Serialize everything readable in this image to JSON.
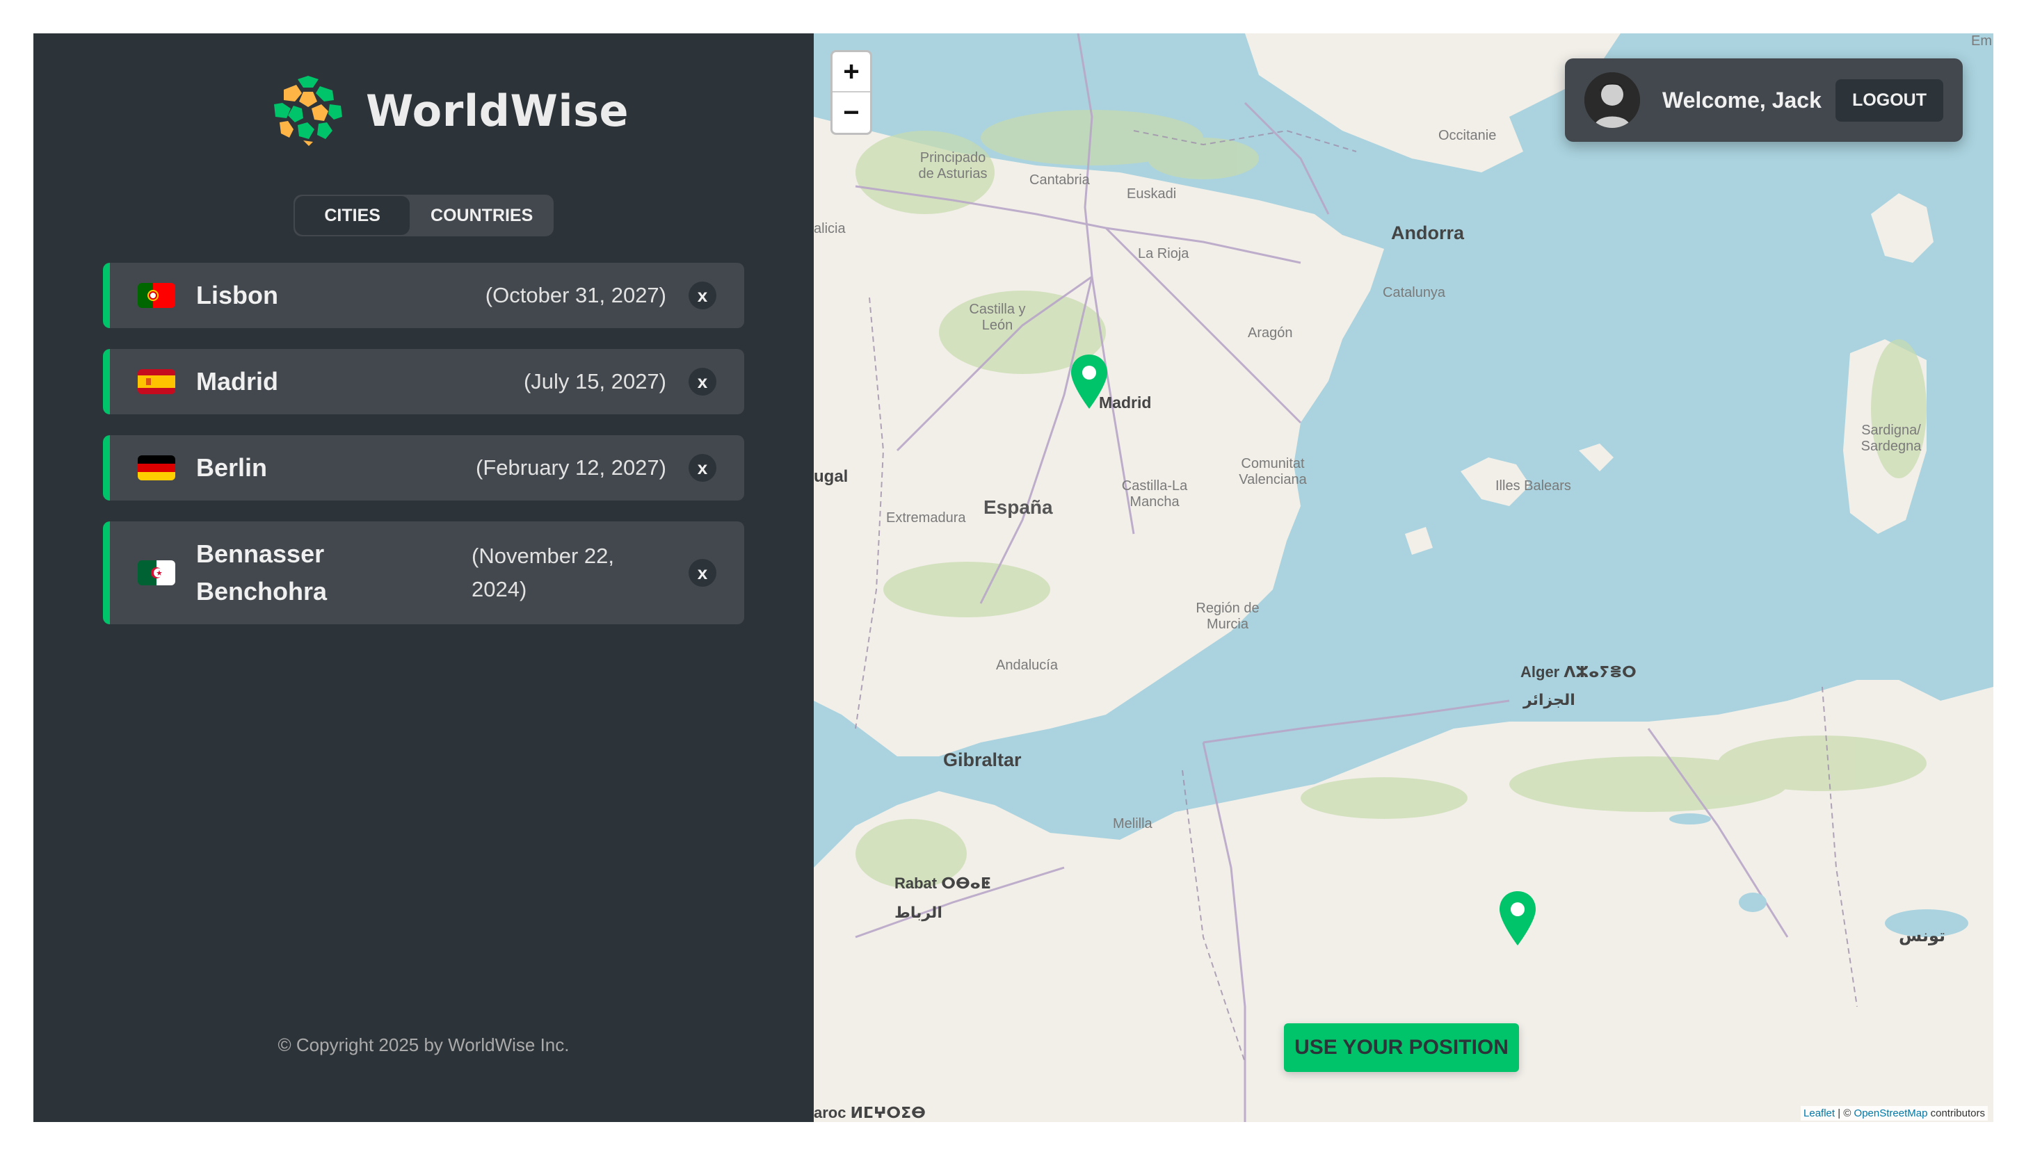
{
  "brand": {
    "name": "WorldWise"
  },
  "tabs": [
    {
      "label": "CITIES",
      "active": true
    },
    {
      "label": "COUNTRIES",
      "active": false
    }
  ],
  "cities": [
    {
      "name": "Lisbon",
      "date": "(October 31, 2027)",
      "flag": "portugal",
      "delete_label": "x"
    },
    {
      "name": "Madrid",
      "date": "(July 15, 2027)",
      "flag": "spain",
      "delete_label": "x"
    },
    {
      "name": "Berlin",
      "date": "(February 12, 2027)",
      "flag": "germany",
      "delete_label": "x"
    },
    {
      "name": "Bennasser Benchohra",
      "date": "(November 22, 2024)",
      "flag": "algeria",
      "delete_label": "x"
    }
  ],
  "footer": {
    "copyright": "© Copyright 2025 by WorldWise Inc."
  },
  "map": {
    "zoom_in": "+",
    "zoom_out": "−",
    "user": {
      "welcome": "Welcome, Jack",
      "logout_label": "LOGOUT"
    },
    "use_position_label": "USE YOUR POSITION",
    "attribution": {
      "leaflet": "Leaflet",
      "sep": "| ©",
      "osm": "OpenStreetMap",
      "suffix": "contributors"
    },
    "labels": {
      "andorra": "Andorra",
      "madrid": "Madrid",
      "espana": "España",
      "gibraltar": "Gibraltar",
      "alger": "Alger ⴷⵣⴰⵢⴻⵔ",
      "alger_ar": "الجزائر",
      "rabat": "Rabat ⵔⴱⴰⵟ",
      "rabat_ar": "الرباط",
      "tunis_ar": "تونس",
      "asturias": "Principado de Asturias",
      "cantabria": "Cantabria",
      "euskadi": "Euskadi",
      "la_rioja": "La Rioja",
      "catalunya": "Catalunya",
      "aragon": "Aragón",
      "castilla_leon": "Castilla y León",
      "extremadura": "Extremadura",
      "castilla_mancha": "Castilla-La Mancha",
      "valenciana": "Comunitat Valenciana",
      "murcia": "Región de Murcia",
      "andalucia": "Andalucía",
      "illes_balears": "Illes Balears",
      "melilla": "Melilla",
      "occitanie": "Occitanie",
      "sardegna": "Sardigna/ Sardegna",
      "galicia": "alicia",
      "portugal": "ugal",
      "maroc": "aroc ⵍⵎⵖⵔⵉⴱ",
      "em": "Em"
    },
    "colors": {
      "sea": "#aad3df",
      "land": "#f2efe9",
      "accent": "#00c46a"
    }
  }
}
